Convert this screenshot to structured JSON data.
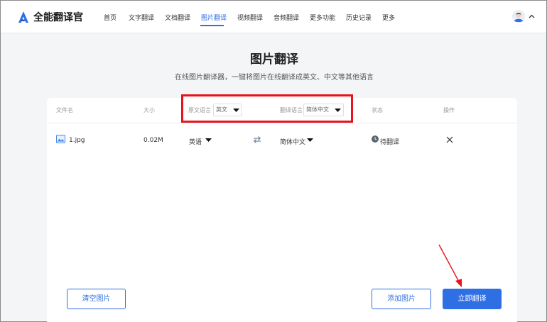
{
  "header": {
    "logo_text": "全能翻译官",
    "nav": [
      "首页",
      "文字翻译",
      "文档翻译",
      "图片翻译",
      "视频翻译",
      "音频翻译",
      "更多功能",
      "历史记录",
      "更多"
    ],
    "active_tab": "图片翻译"
  },
  "page": {
    "title": "图片翻译",
    "subtitle": "在线图片翻译器，一键将图片在线翻译成英文、中文等其他语言"
  },
  "table": {
    "columns": {
      "filename": "文件名",
      "size": "大小",
      "source_lang": "原文语言",
      "target_lang": "翻译语言",
      "status": "状态",
      "action": "操作"
    },
    "source_lang_value": "英文",
    "target_lang_value": "简体中文",
    "rows": [
      {
        "filename": "1.jpg",
        "size": "0.02M",
        "source": "英语",
        "target": "简体中文",
        "status": "待翻译"
      }
    ]
  },
  "buttons": {
    "clear": "清空图片",
    "add": "添加图片",
    "translate": "立即翻译"
  },
  "colors": {
    "accent": "#2f6fe4",
    "annotation": "#e8141b"
  },
  "icons": [
    "logo-a-icon",
    "avatar-icon",
    "chevron-up-icon",
    "caret-down-icon",
    "image-file-icon",
    "swap-icon",
    "clock-icon",
    "close-icon",
    "red-arrow-annotation"
  ]
}
